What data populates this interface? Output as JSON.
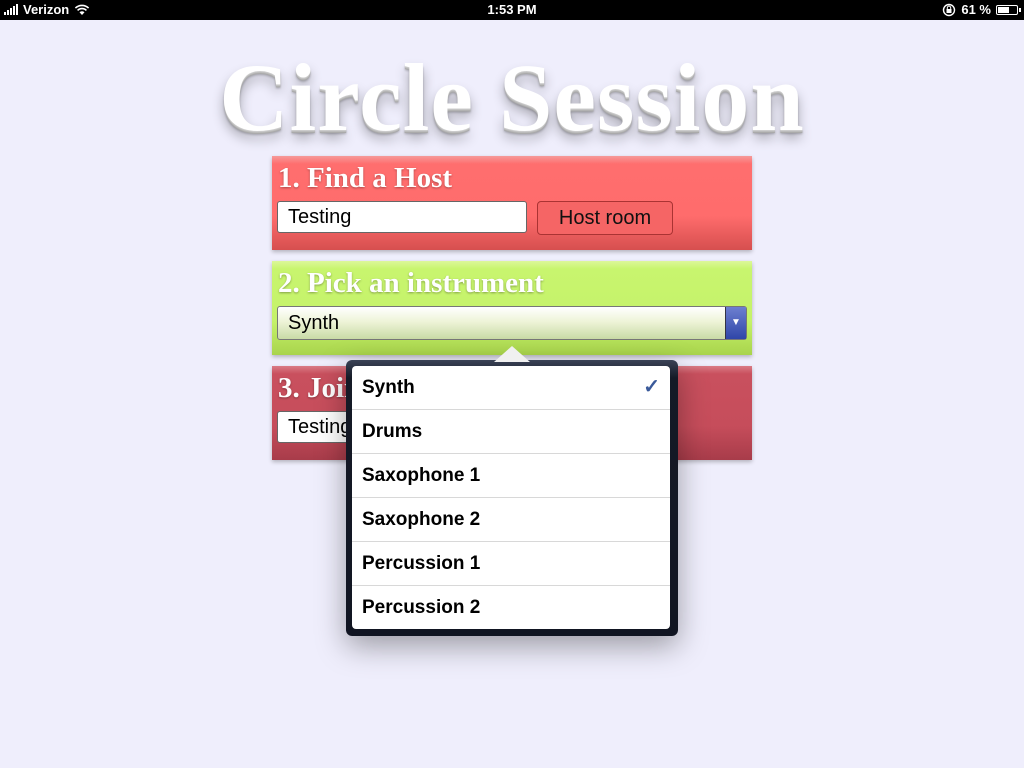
{
  "status_bar": {
    "carrier": "Verizon",
    "time": "1:53 PM",
    "battery_text": "61 %",
    "battery_level": 0.61
  },
  "app": {
    "title": "Circle Session"
  },
  "step1": {
    "heading": "1. Find a Host",
    "name_value": "Testing",
    "host_button": "Host room",
    "color": "#ff6c6c"
  },
  "step2": {
    "heading": "2. Pick an instrument",
    "selected": "Synth",
    "color": "#c5f26a"
  },
  "step3": {
    "heading": "3. Join",
    "name_value": "Testing",
    "color": "#c64d5b"
  },
  "instrument_picker": {
    "options": [
      "Synth",
      "Drums",
      "Saxophone 1",
      "Saxophone 2",
      "Percussion 1",
      "Percussion 2"
    ],
    "checked_index": 0,
    "check_icon": "checkmark-icon"
  }
}
